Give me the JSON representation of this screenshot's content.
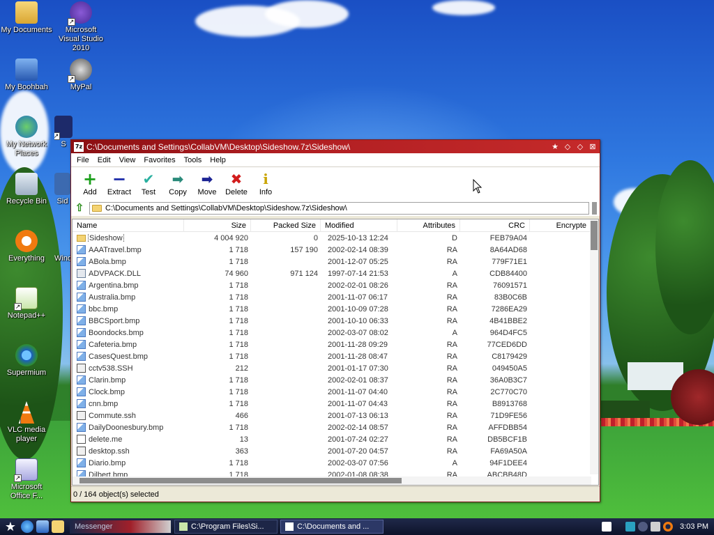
{
  "desktop": {
    "icons": [
      {
        "label": "My Documents"
      },
      {
        "label": "Microsoft Visual Studio 2010"
      },
      {
        "label": "My Boohbah"
      },
      {
        "label": "MyPal"
      },
      {
        "label": "My Network Places"
      },
      {
        "label": "S"
      },
      {
        "label": "Recycle Bin"
      },
      {
        "label": "Sid"
      },
      {
        "label": "Everything"
      },
      {
        "label": "Wind"
      },
      {
        "label": "Notepad++"
      },
      {
        "label": "Supermium"
      },
      {
        "label": "VLC media player"
      },
      {
        "label": "Microsoft Office F..."
      }
    ]
  },
  "window": {
    "app_icon": "7z",
    "title": "C:\\Documents and Settings\\CollabVM\\Desktop\\Sideshow.7z\\Sideshow\\",
    "menu": [
      "File",
      "Edit",
      "View",
      "Favorites",
      "Tools",
      "Help"
    ],
    "toolbar": [
      {
        "label": "Add",
        "icon": "add-icon",
        "color": "#1a9f1a",
        "glyph": "+"
      },
      {
        "label": "Extract",
        "icon": "extract-icon",
        "color": "#1b2aa8",
        "glyph": "−"
      },
      {
        "label": "Test",
        "icon": "test-icon",
        "color": "#2ab0a0",
        "glyph": "✔"
      },
      {
        "label": "Copy",
        "icon": "copy-icon",
        "color": "#2a8a7a",
        "glyph": "➡"
      },
      {
        "label": "Move",
        "icon": "move-icon",
        "color": "#1c2494",
        "glyph": "➡"
      },
      {
        "label": "Delete",
        "icon": "delete-icon",
        "color": "#d21c1c",
        "glyph": "✖"
      },
      {
        "label": "Info",
        "icon": "info-icon",
        "color": "#c9a400",
        "glyph": "i"
      }
    ],
    "address": "C:\\Documents and Settings\\CollabVM\\Desktop\\Sideshow.7z\\Sideshow\\",
    "columns": [
      "Name",
      "Size",
      "Packed Size",
      "Modified",
      "Attributes",
      "CRC",
      "Encrypte"
    ],
    "rows": [
      {
        "type": "folder",
        "name": "Sideshow",
        "size": "4 004 920",
        "packed": "0",
        "modified": "2025-10-13 12:24",
        "attr": "D",
        "crc": "FEB79A04"
      },
      {
        "type": "bmp",
        "name": "AAATravel.bmp",
        "size": "1 718",
        "packed": "157 190",
        "modified": "2002-02-14 08:39",
        "attr": "RA",
        "crc": "8A64AD68"
      },
      {
        "type": "bmp",
        "name": "ABola.bmp",
        "size": "1 718",
        "packed": "",
        "modified": "2001-12-07 05:25",
        "attr": "RA",
        "crc": "779F71E1"
      },
      {
        "type": "dll",
        "name": "ADVPACK.DLL",
        "size": "74 960",
        "packed": "971 124",
        "modified": "1997-07-14 21:53",
        "attr": "A",
        "crc": "CDB84400"
      },
      {
        "type": "bmp",
        "name": "Argentina.bmp",
        "size": "1 718",
        "packed": "",
        "modified": "2002-02-01 08:26",
        "attr": "RA",
        "crc": "76091571"
      },
      {
        "type": "bmp",
        "name": "Australia.bmp",
        "size": "1 718",
        "packed": "",
        "modified": "2001-11-07 06:17",
        "attr": "RA",
        "crc": "83B0C6B"
      },
      {
        "type": "bmp",
        "name": "bbc.bmp",
        "size": "1 718",
        "packed": "",
        "modified": "2001-10-09 07:28",
        "attr": "RA",
        "crc": "7286EA29"
      },
      {
        "type": "bmp",
        "name": "BBCSport.bmp",
        "size": "1 718",
        "packed": "",
        "modified": "2001-10-10 06:33",
        "attr": "RA",
        "crc": "4B41BBE2"
      },
      {
        "type": "bmp",
        "name": "Boondocks.bmp",
        "size": "1 718",
        "packed": "",
        "modified": "2002-03-07 08:02",
        "attr": "A",
        "crc": "964D4FC5"
      },
      {
        "type": "bmp",
        "name": "Cafeteria.bmp",
        "size": "1 718",
        "packed": "",
        "modified": "2001-11-28 09:29",
        "attr": "RA",
        "crc": "77CED6DD"
      },
      {
        "type": "bmp",
        "name": "CasesQuest.bmp",
        "size": "1 718",
        "packed": "",
        "modified": "2001-11-28 08:47",
        "attr": "RA",
        "crc": "C8179429"
      },
      {
        "type": "ssh",
        "name": "cctv538.SSH",
        "size": "212",
        "packed": "",
        "modified": "2001-01-17 07:30",
        "attr": "RA",
        "crc": "049450A5"
      },
      {
        "type": "bmp",
        "name": "Clarin.bmp",
        "size": "1 718",
        "packed": "",
        "modified": "2002-02-01 08:37",
        "attr": "RA",
        "crc": "36A0B3C7"
      },
      {
        "type": "bmp",
        "name": "Clock.bmp",
        "size": "1 718",
        "packed": "",
        "modified": "2001-11-07 04:40",
        "attr": "RA",
        "crc": "2C770C70"
      },
      {
        "type": "bmp",
        "name": "cnn.bmp",
        "size": "1 718",
        "packed": "",
        "modified": "2001-11-07 04:43",
        "attr": "RA",
        "crc": "B8913768"
      },
      {
        "type": "ssh",
        "name": "Commute.ssh",
        "size": "466",
        "packed": "",
        "modified": "2001-07-13 06:13",
        "attr": "RA",
        "crc": "71D9FE56"
      },
      {
        "type": "bmp",
        "name": "DailyDoonesbury.bmp",
        "size": "1 718",
        "packed": "",
        "modified": "2002-02-14 08:57",
        "attr": "RA",
        "crc": "AFFDBB54"
      },
      {
        "type": "txt",
        "name": "delete.me",
        "size": "13",
        "packed": "",
        "modified": "2001-07-24 02:27",
        "attr": "RA",
        "crc": "DB5BCF1B"
      },
      {
        "type": "ssh",
        "name": "desktop.ssh",
        "size": "363",
        "packed": "",
        "modified": "2001-07-20 04:57",
        "attr": "RA",
        "crc": "FA69A50A"
      },
      {
        "type": "bmp",
        "name": "Diario.bmp",
        "size": "1 718",
        "packed": "",
        "modified": "2002-03-07 07:56",
        "attr": "A",
        "crc": "94F1DEE4"
      },
      {
        "type": "bmp",
        "name": "Dilbert.bmp",
        "size": "1 718",
        "packed": "",
        "modified": "2002-01-08 08:38",
        "attr": "RA",
        "crc": "ABCBB48D"
      }
    ],
    "status": "0 / 164 object(s) selected"
  },
  "taskbar": {
    "tasks": [
      {
        "label": "Messenger"
      },
      {
        "label": "C:\\Program Files\\Si..."
      },
      {
        "label": "C:\\Documents and ..."
      }
    ],
    "clock": "3:03 PM"
  },
  "colors": {
    "title_bar": "#b01e22",
    "taskbar": "#0d132a",
    "folder": "#f4d373"
  }
}
